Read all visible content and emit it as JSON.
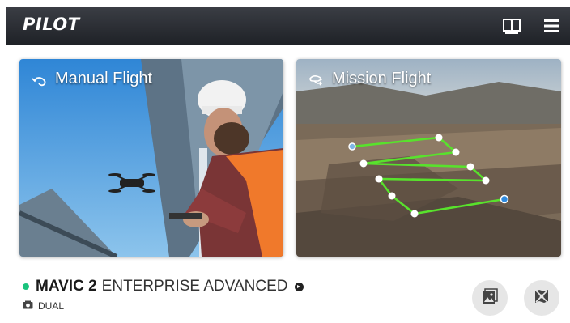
{
  "header": {
    "logo_text": "PILOT",
    "icons": [
      "book-icon",
      "hamburger-menu-icon"
    ],
    "background_color": "#2a2d33"
  },
  "cards": {
    "manual": {
      "title": "Manual Flight",
      "icon": "manual-flight-icon"
    },
    "mission": {
      "title": "Mission Flight",
      "icon": "mission-flight-icon"
    }
  },
  "aircraft": {
    "model_main": "MAVIC 2",
    "model_sub": "ENTERPRISE ADVANCED",
    "status_color": "#19c37d",
    "camera_label": "DUAL",
    "camera_icon": "camera-icon"
  },
  "actions": {
    "album_icon": "album-icon",
    "map_icon": "map-icon"
  },
  "mission_path": {
    "line_color": "#58e22c",
    "start_point_color": "#7fb6e6",
    "end_point_color": "#2f8be0"
  }
}
